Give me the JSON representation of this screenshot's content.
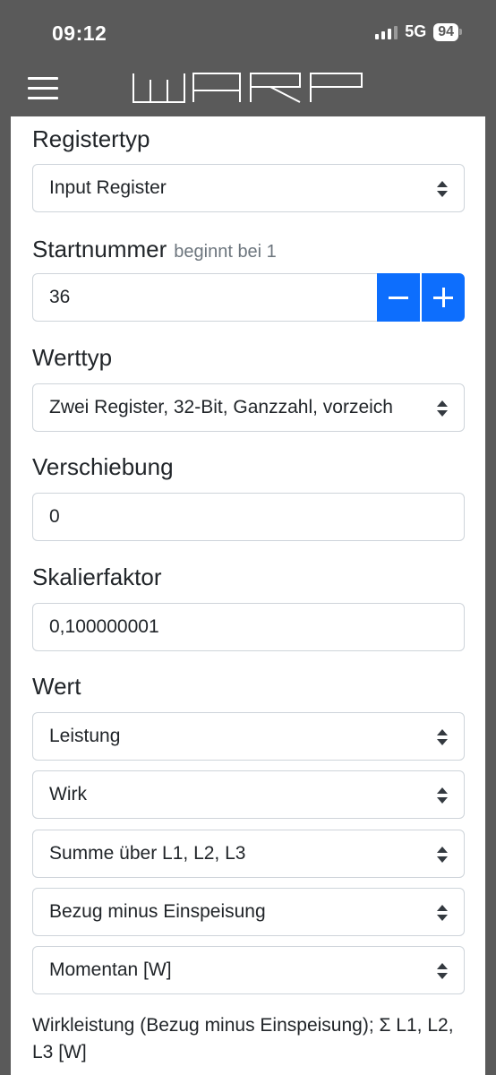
{
  "status": {
    "time": "09:12",
    "network": "5G",
    "battery": "94"
  },
  "form": {
    "register_type": {
      "label": "Registertyp",
      "value": "Input Register"
    },
    "start_number": {
      "label": "Startnummer",
      "hint": "beginnt bei 1",
      "value": "36"
    },
    "value_type": {
      "label": "Werttyp",
      "value": "Zwei Register, 32-Bit, Ganzzahl, vorzeich"
    },
    "offset": {
      "label": "Verschiebung",
      "value": "0"
    },
    "scale": {
      "label": "Skalierfaktor",
      "value": "0,100000001"
    },
    "value": {
      "label": "Wert",
      "selects": [
        "Leistung",
        "Wirk",
        "Summe über L1, L2, L3",
        "Bezug minus Einspeisung",
        "Momentan [W]"
      ],
      "description": "Wirkleistung (Bezug minus Einspeisung); Σ L1, L2, L3 [W]"
    }
  },
  "icons": {
    "menu": "hamburger-icon",
    "logo": "warp-logo",
    "minus": "minus-icon",
    "plus": "plus-icon",
    "select": "select-caret-icon"
  },
  "colors": {
    "header": "#5a5a5a",
    "accent": "#0d6efd"
  }
}
